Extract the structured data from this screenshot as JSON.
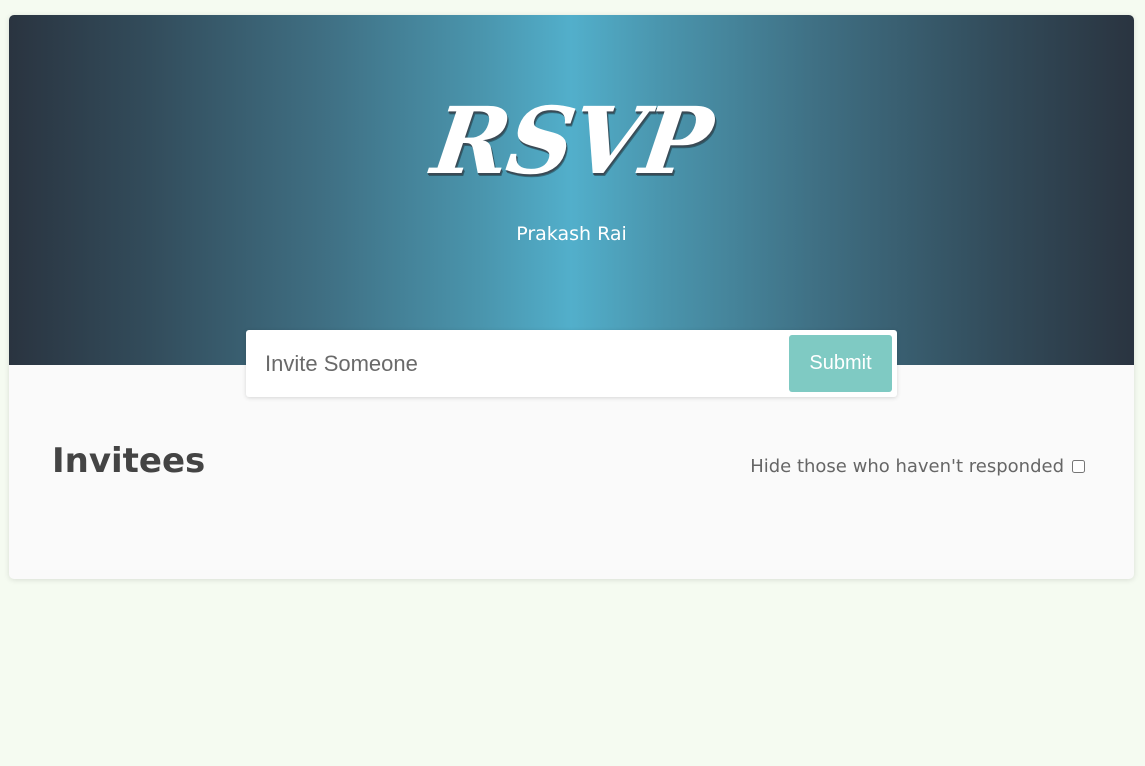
{
  "header": {
    "logo_text": "RSVP",
    "author": "Prakash Rai"
  },
  "invite_form": {
    "placeholder": "Invite Someone",
    "value": "",
    "submit_label": "Submit"
  },
  "main": {
    "title": "Invitees",
    "filter_label": "Hide those who haven't responded",
    "filter_checked": false
  },
  "colors": {
    "page_background": "#f5fbf1",
    "header_center": "#52afcb",
    "header_edge": "#2a3440",
    "submit_button": "#7fcac3",
    "heading_text": "#444444"
  }
}
